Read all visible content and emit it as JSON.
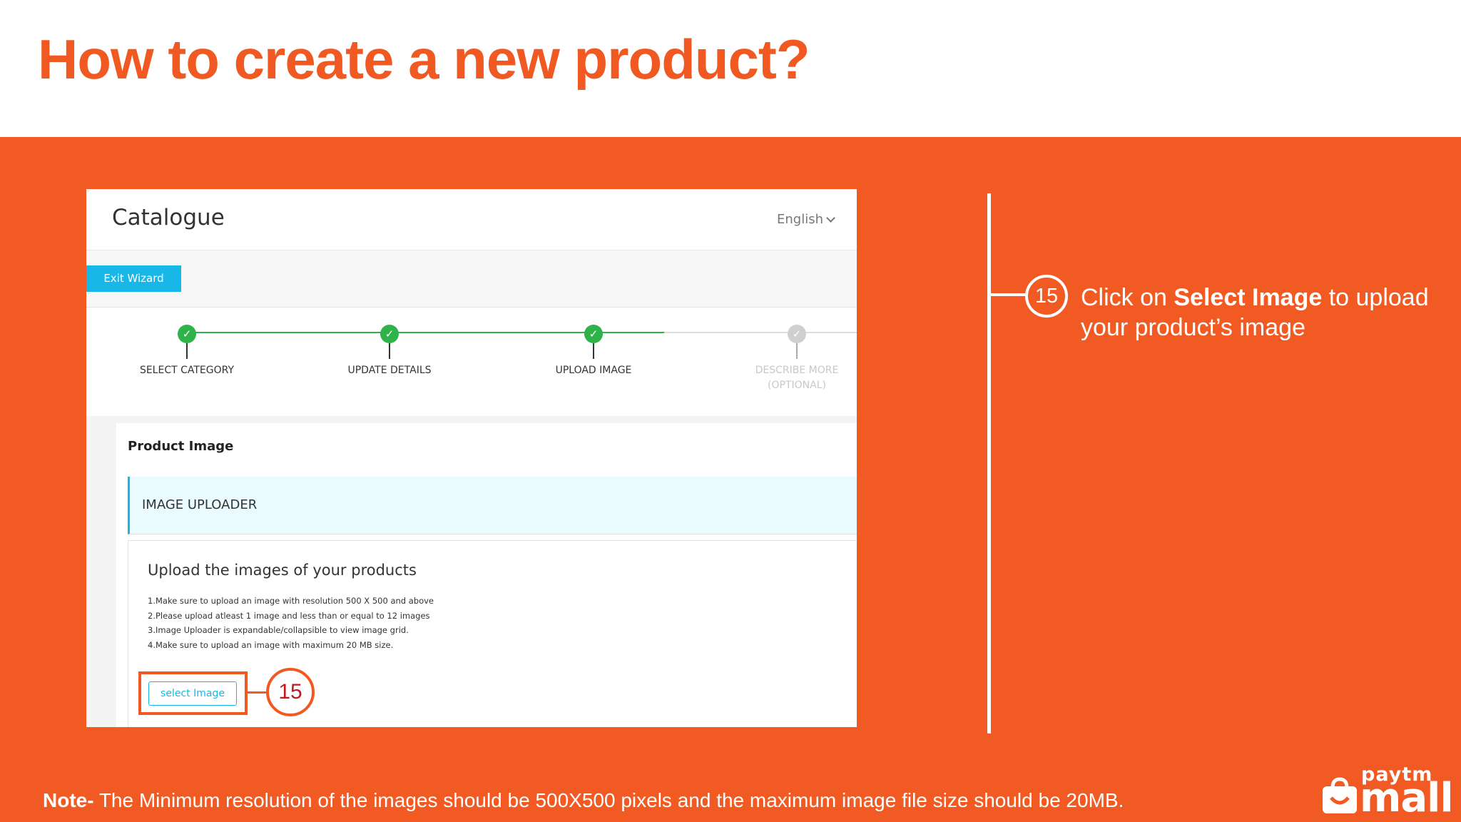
{
  "slide": {
    "title": "How to create a new product?",
    "note_bold": "Note-",
    "note_text": " The Minimum resolution of the images should be 500X500 pixels and the maximum image file size should be 20MB.",
    "colors": {
      "brand_orange": "#f15a22",
      "accent_cyan": "#17b7e8",
      "step_done_green": "#2eb34a",
      "highlight_red": "#c2181f"
    }
  },
  "app": {
    "title": "Catalogue",
    "language": "English",
    "exit_wizard": "Exit Wizard",
    "steps": [
      {
        "label": "SELECT CATEGORY",
        "state": "done"
      },
      {
        "label": "UPDATE DETAILS",
        "state": "done"
      },
      {
        "label": "UPLOAD IMAGE",
        "state": "done"
      },
      {
        "label": "DESCRIBE MORE",
        "label2": "(OPTIONAL)",
        "state": "pending"
      }
    ],
    "section_title": "Product Image",
    "uploader_title": "IMAGE UPLOADER",
    "upload_heading": "Upload the images of your products",
    "rules": [
      "1.Make sure to upload an image with resolution 500 X 500 and above",
      "2.Please upload atleast 1 image and less than or equal to 12 images",
      "3.Image Uploader is expandable/collapsible to view image grid.",
      "4.Make sure to upload an image with maximum 20 MB size."
    ],
    "select_image": "select Image"
  },
  "annotation": {
    "step_number": "15",
    "text_prefix": "Click on ",
    "text_bold": "Select Image",
    "text_suffix": " to upload your product’s image"
  },
  "logo": {
    "top": "paytm",
    "bottom": "mall"
  }
}
